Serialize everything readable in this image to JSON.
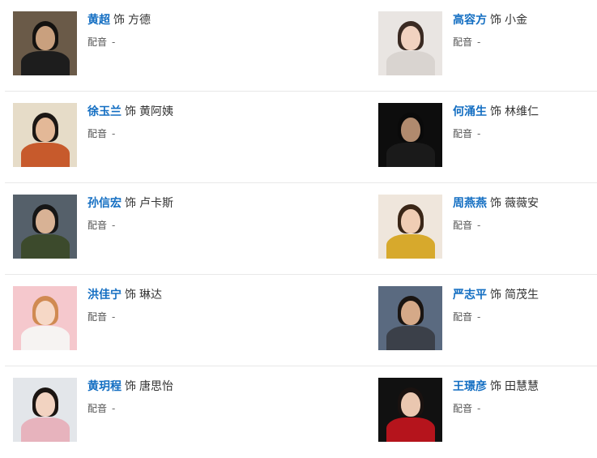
{
  "dub_label": "配音",
  "rows": [
    {
      "left": {
        "actor": "黄超",
        "shi": "饰",
        "role": "方德",
        "dub": "-",
        "photo": {
          "bg": "#6a5a48",
          "skin": "#c9a07e",
          "hair": "#141210",
          "body": "#1d1d1d"
        }
      },
      "right": {
        "actor": "高容方",
        "shi": "饰",
        "role": "小金",
        "dub": "-",
        "photo": {
          "bg": "#e9e5e2",
          "skin": "#f1d2c0",
          "hair": "#3a2a22",
          "body": "#d9d4d0"
        }
      }
    },
    {
      "left": {
        "actor": "徐玉兰",
        "shi": "饰",
        "role": "黄阿姨",
        "dub": "-",
        "photo": {
          "bg": "#e6dcc8",
          "skin": "#e3b897",
          "hair": "#1c1714",
          "body": "#c75a2c"
        }
      },
      "right": {
        "actor": "何涌生",
        "shi": "饰",
        "role": "林维仁",
        "dub": "-",
        "photo": {
          "bg": "#0d0d0d",
          "skin": "#b08a6e",
          "hair": "#0a0a0a",
          "body": "#1a1a1a"
        }
      }
    },
    {
      "left": {
        "actor": "孙信宏",
        "shi": "饰",
        "role": "卢卡斯",
        "dub": "-",
        "photo": {
          "bg": "#55606a",
          "skin": "#d8b295",
          "hair": "#161616",
          "body": "#3c4a2c"
        }
      },
      "right": {
        "actor": "周燕燕",
        "shi": "饰",
        "role": "薇薇安",
        "dub": "-",
        "photo": {
          "bg": "#efe6dc",
          "skin": "#f0cdb4",
          "hair": "#3a2617",
          "body": "#d7a92c"
        }
      }
    },
    {
      "left": {
        "actor": "洪佳宁",
        "shi": "饰",
        "role": "琳达",
        "dub": "-",
        "photo": {
          "bg": "#f5c8cd",
          "skin": "#f6d8c6",
          "hair": "#d08a52",
          "body": "#f6f3f2"
        }
      },
      "right": {
        "actor": "严志平",
        "shi": "饰",
        "role": "简茂生",
        "dub": "-",
        "photo": {
          "bg": "#5a6a80",
          "skin": "#d5a988",
          "hair": "#1a1512",
          "body": "#3b4049"
        }
      }
    },
    {
      "left": {
        "actor": "黄玥程",
        "shi": "饰",
        "role": "唐思怡",
        "dub": "-",
        "photo": {
          "bg": "#e3e6ea",
          "skin": "#f2d3c1",
          "hair": "#1b1512",
          "body": "#e7b3bd"
        }
      },
      "right": {
        "actor": "王璟彦",
        "shi": "饰",
        "role": "田慧慧",
        "dub": "-",
        "photo": {
          "bg": "#111111",
          "skin": "#eac7b0",
          "hair": "#1a1210",
          "body": "#b5141c"
        }
      }
    }
  ]
}
